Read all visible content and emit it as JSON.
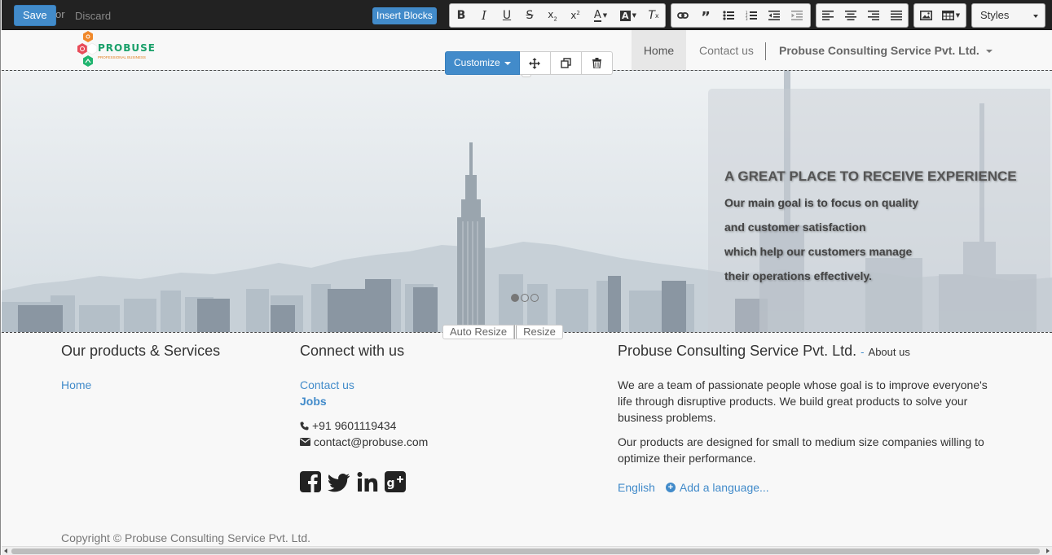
{
  "editor_toolbar": {
    "save_label": "Save",
    "or_label": "or",
    "discard_label": "Discard",
    "insert_blocks_label": "Insert Blocks",
    "styles_label": "Styles",
    "format_buttons": [
      "bold-icon",
      "italic-icon",
      "underline-icon",
      "strikethrough-icon",
      "subscript-icon",
      "superscript-icon",
      "font-color-icon",
      "background-color-icon",
      "clear-format-icon"
    ],
    "insert_buttons": [
      "link-icon",
      "quote-icon",
      "unordered-list-icon",
      "ordered-list-icon",
      "outdent-icon",
      "indent-icon"
    ],
    "align_buttons": [
      "align-left-icon",
      "align-center-icon",
      "align-right-icon",
      "align-justify-icon"
    ],
    "media_buttons": [
      "picture-icon",
      "table-icon"
    ],
    "accent_color": "#428bca"
  },
  "header": {
    "logo_text": "PROBUSE",
    "logo_subtext": "PROFESSIONAL BUSINESS",
    "nav": {
      "home": "Home",
      "contact": "Contact us",
      "company": "Probuse Consulting Service Pvt. Ltd."
    }
  },
  "block_overlay": {
    "customize_label": "Customize",
    "move_icon": "move-icon",
    "clone_icon": "clone-icon",
    "delete_icon": "trash-icon"
  },
  "banner": {
    "title": "A GREAT PLACE TO RECEIVE EXPERIENCE",
    "lines": [
      "Our main goal is to focus on quality",
      "and customer satisfaction",
      "which help our customers manage",
      "their operations effectively."
    ],
    "slide_count": 3,
    "active_slide": 1,
    "auto_resize_label": "Auto Resize",
    "resize_label": "Resize"
  },
  "footer": {
    "products": {
      "title": "Our products & Services",
      "links": [
        "Home"
      ]
    },
    "connect": {
      "title": "Connect with us",
      "links": [
        "Contact us"
      ],
      "jobs": "Jobs",
      "phone": "+91 9601119434",
      "email": "contact@probuse.com",
      "social": [
        "facebook-icon",
        "twitter-icon",
        "linkedin-icon",
        "google-plus-icon"
      ]
    },
    "company": {
      "title": "Probuse Consulting Service Pvt. Ltd.",
      "about_sep": "-",
      "about_label": "About us",
      "paragraph1": "We are a team of passionate people whose goal is to improve everyone's life through disruptive products. We build great products to solve your business problems.",
      "paragraph2": "Our products are designed for small to medium size companies willing to optimize their performance.",
      "language": "English",
      "add_language": "Add a language..."
    },
    "copyright": "Copyright © Probuse Consulting Service Pvt. Ltd."
  }
}
